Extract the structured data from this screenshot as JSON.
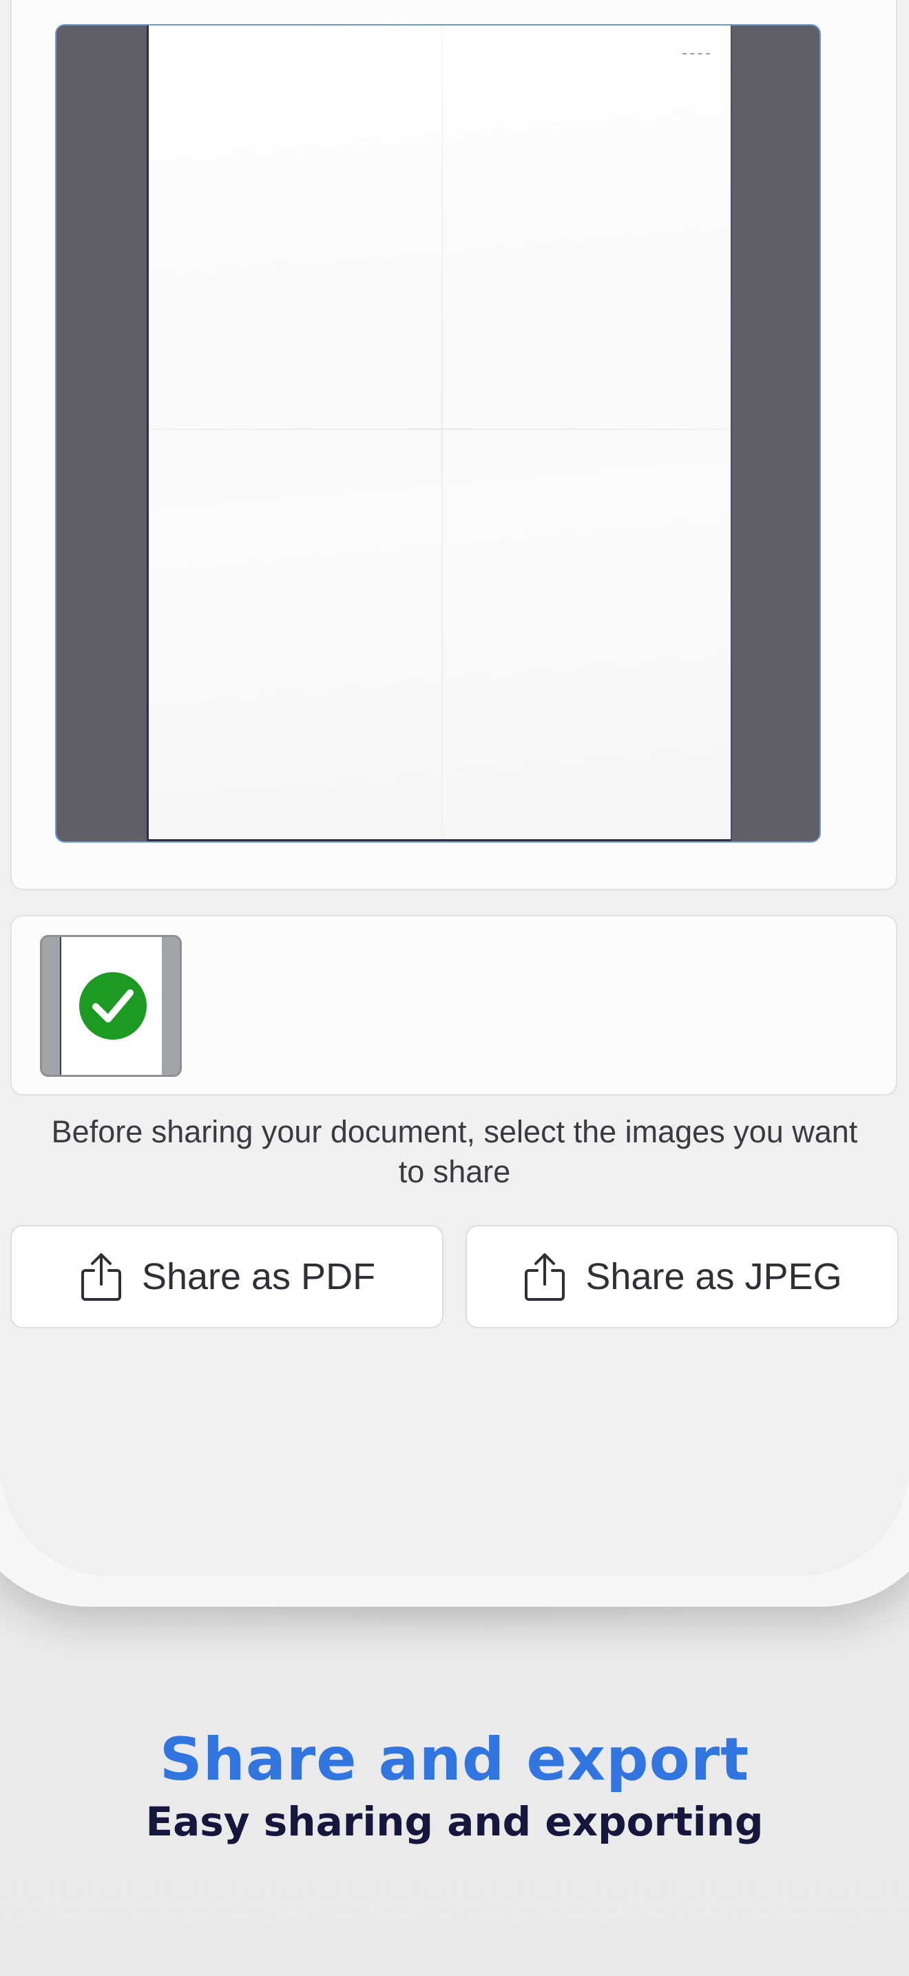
{
  "document": {
    "pages_count": 1,
    "selected_pages": 1
  },
  "thumbnail": {
    "selected": true,
    "check_icon": "checkmark-circle-icon"
  },
  "helper_text": "Before sharing your document, select the images you want to share",
  "actions": {
    "share_pdf_label": "Share as PDF",
    "share_jpeg_label": "Share as JPEG",
    "share_icon": "share-icon"
  },
  "caption": {
    "title": "Share and export",
    "subtitle": "Easy sharing and exporting"
  },
  "colors": {
    "accent_blue": "#3075e0",
    "dark_navy": "#17163d",
    "check_green": "#1c9a22",
    "preview_border": "#6f98d8",
    "preview_backdrop": "#5f5f65"
  }
}
